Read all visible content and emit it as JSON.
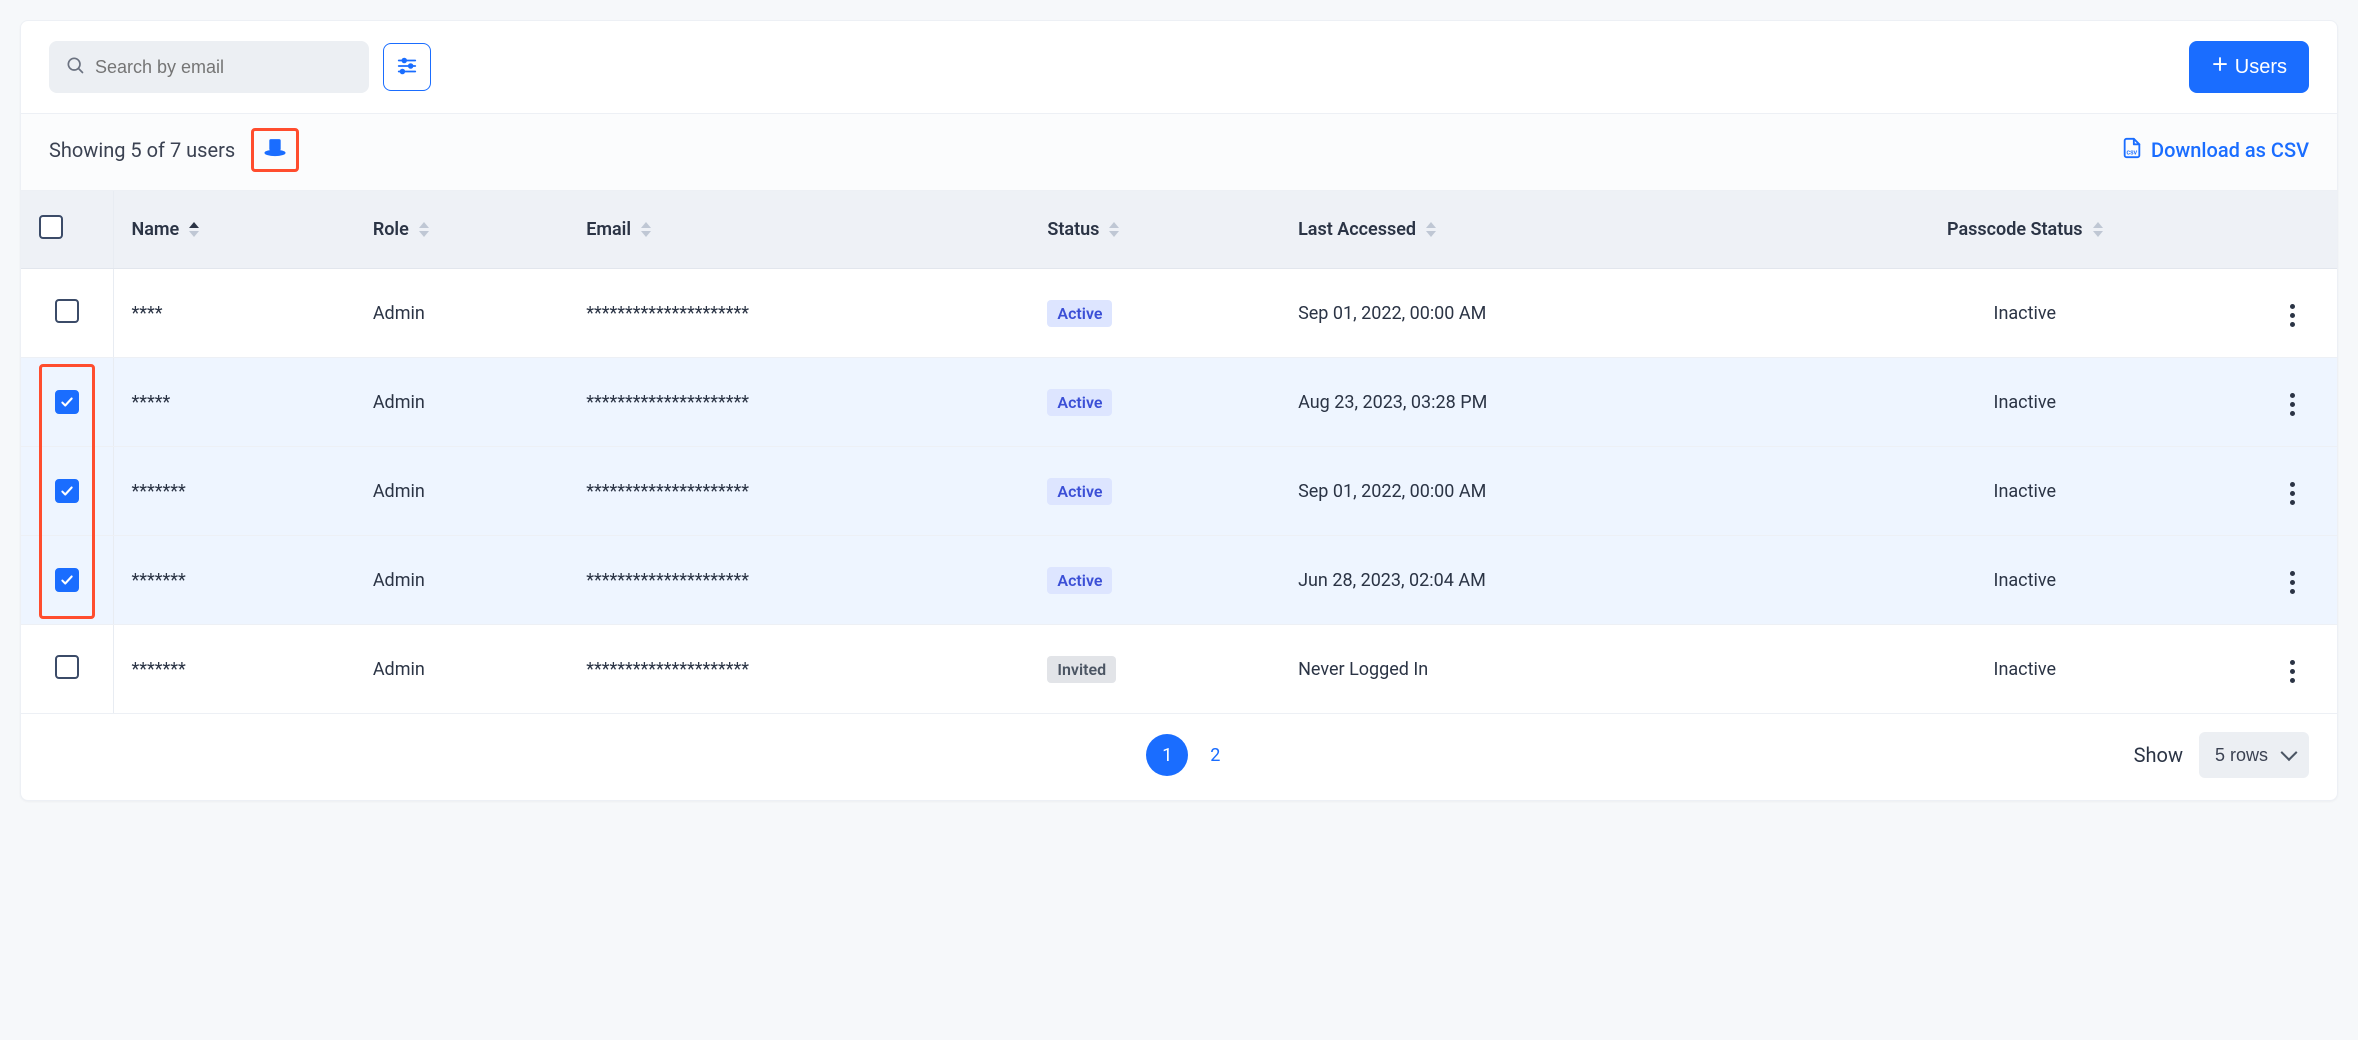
{
  "toolbar": {
    "search_placeholder": "Search by email",
    "add_button_label": "Users"
  },
  "subbar": {
    "showing_text": "Showing 5 of 7 users",
    "download_label": "Download as CSV"
  },
  "columns": {
    "name": "Name",
    "role": "Role",
    "email": "Email",
    "status": "Status",
    "last_accessed": "Last Accessed",
    "passcode_status": "Passcode Status"
  },
  "rows": [
    {
      "selected": false,
      "name": "****",
      "role": "Admin",
      "email": "*********************",
      "status": "Active",
      "status_kind": "active",
      "last_accessed": "Sep 01, 2022, 00:00 AM",
      "passcode_status": "Inactive"
    },
    {
      "selected": true,
      "name": "*****",
      "role": "Admin",
      "email": "*********************",
      "status": "Active",
      "status_kind": "active",
      "last_accessed": "Aug 23, 2023, 03:28 PM",
      "passcode_status": "Inactive"
    },
    {
      "selected": true,
      "name": "*******",
      "role": "Admin",
      "email": "*********************",
      "status": "Active",
      "status_kind": "active",
      "last_accessed": "Sep 01, 2022, 00:00 AM",
      "passcode_status": "Inactive"
    },
    {
      "selected": true,
      "name": "*******",
      "role": "Admin",
      "email": "*********************",
      "status": "Active",
      "status_kind": "active",
      "last_accessed": "Jun 28, 2023, 02:04 AM",
      "passcode_status": "Inactive"
    },
    {
      "selected": false,
      "name": "*******",
      "role": "Admin",
      "email": "*********************",
      "status": "Invited",
      "status_kind": "invited",
      "last_accessed": "Never Logged In",
      "passcode_status": "Inactive"
    }
  ],
  "pagination": {
    "pages": [
      "1",
      "2"
    ],
    "active_index": 0,
    "show_label": "Show",
    "rows_select_value": "5 rows"
  }
}
